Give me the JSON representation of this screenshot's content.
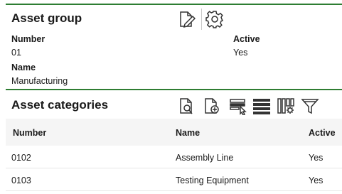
{
  "asset_group": {
    "title": "Asset group",
    "number_label": "Number",
    "number_value": "01",
    "active_label": "Active",
    "active_value": "Yes",
    "name_label": "Name",
    "name_value": "Manufacturing"
  },
  "asset_categories": {
    "title": "Asset categories",
    "columns": [
      "Number",
      "Name",
      "Active"
    ],
    "rows": [
      {
        "number": "0102",
        "name": "Assembly Line",
        "active": "Yes"
      },
      {
        "number": "0103",
        "name": "Testing Equipment",
        "active": "Yes"
      }
    ]
  },
  "icons": {
    "group_toolbar": [
      "edit-document-icon",
      "settings-gear-icon"
    ],
    "categories_toolbar": [
      "view-document-icon",
      "new-document-icon",
      "select-rows-icon",
      "list-view-icon",
      "column-settings-icon",
      "filter-icon"
    ]
  },
  "colors": {
    "accent_line": "#2e7d32",
    "header_bg": "#f5f5f5"
  }
}
